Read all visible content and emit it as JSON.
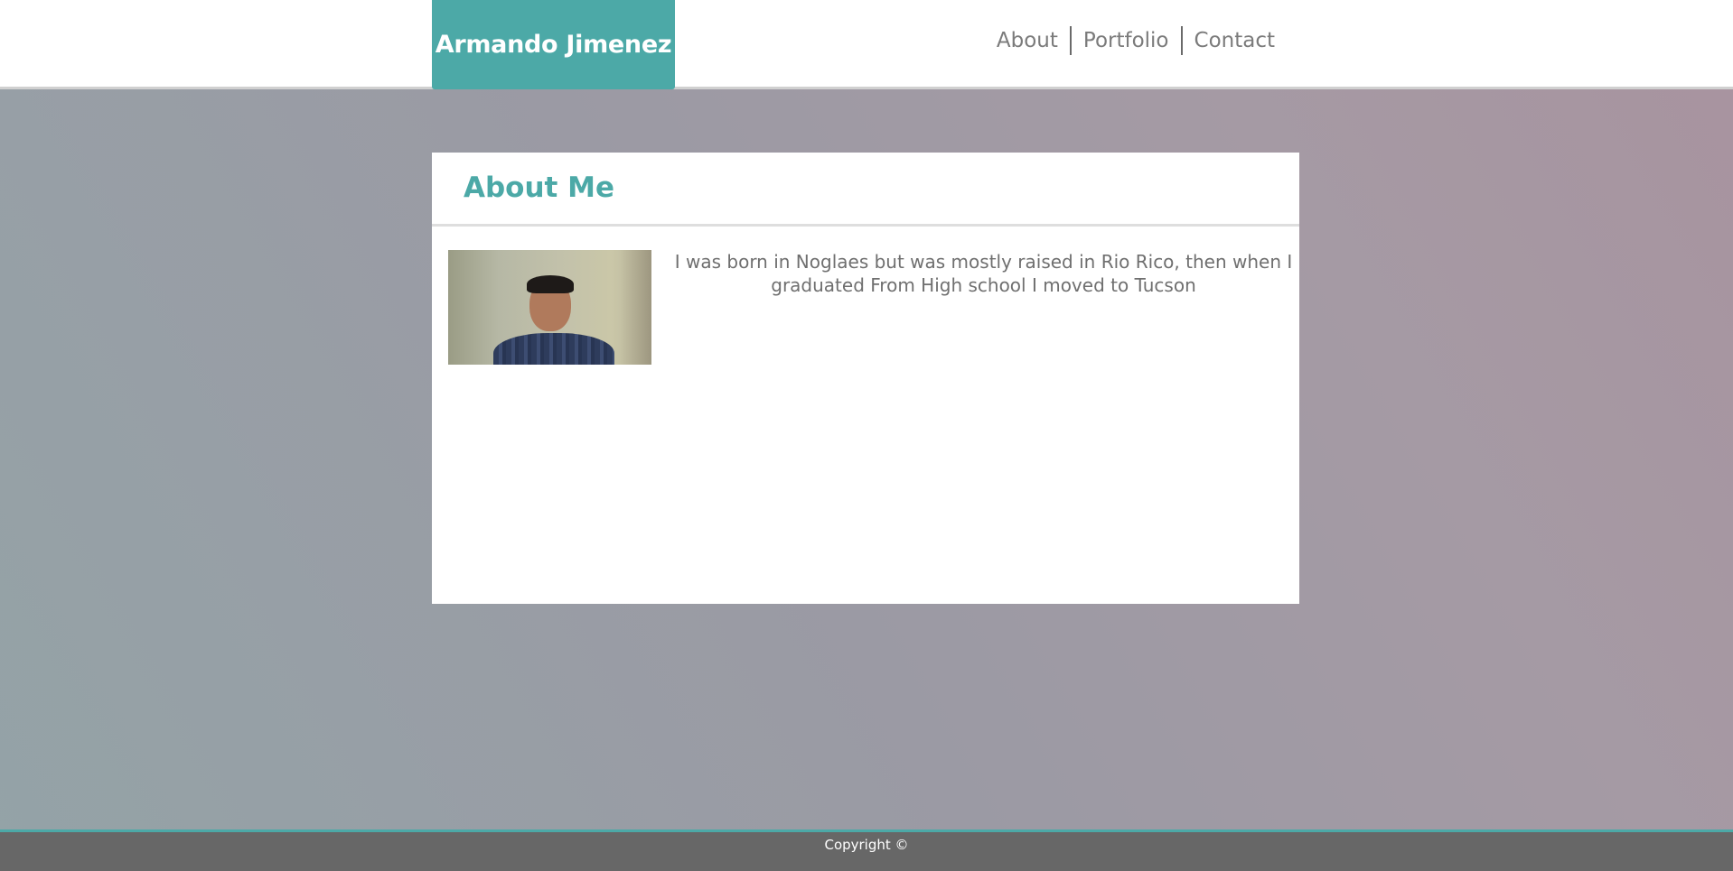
{
  "header": {
    "brand": "Armando Jimenez",
    "nav": [
      {
        "label": "About"
      },
      {
        "label": "Portfolio"
      },
      {
        "label": "Contact"
      }
    ]
  },
  "about": {
    "title": "About Me",
    "text": "I was born in Noglaes but was mostly raised in Rio Rico, then when I graduated From High school I moved to Tucson"
  },
  "footer": {
    "text": "Copyright ©"
  },
  "colors": {
    "accent": "#4ca9a7",
    "nav_text": "#7b7b7b",
    "footer_bg": "#676767"
  }
}
